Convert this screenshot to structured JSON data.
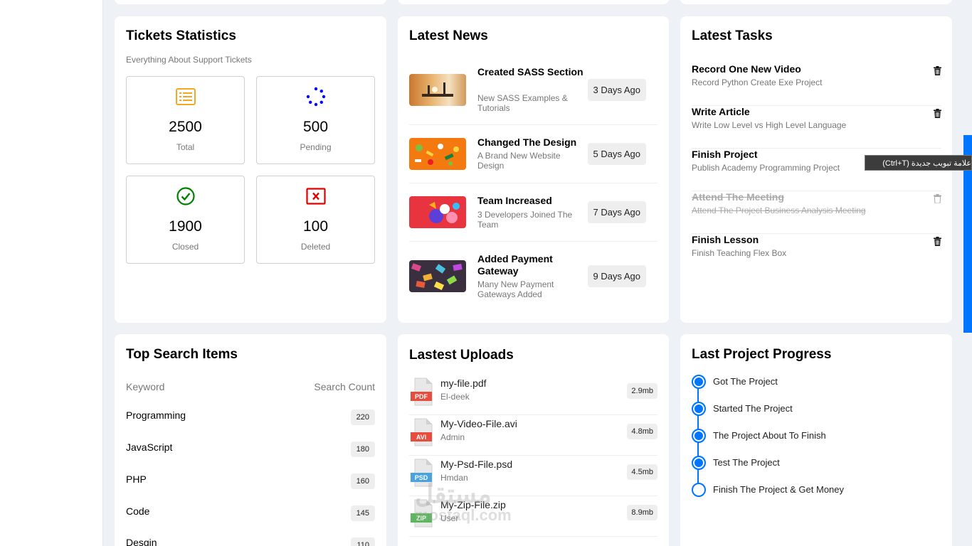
{
  "tickets": {
    "title": "Tickets Statistics",
    "subtitle": "Everything About Support Tickets",
    "items": [
      {
        "value": "2500",
        "label": "Total",
        "icon": "list-icon",
        "color": "#f5a623"
      },
      {
        "value": "500",
        "label": "Pending",
        "icon": "spinner-icon",
        "color": "#0000ff"
      },
      {
        "value": "1900",
        "label": "Closed",
        "icon": "check-circle-icon",
        "color": "#008000"
      },
      {
        "value": "100",
        "label": "Deleted",
        "icon": "x-square-icon",
        "color": "#e00000"
      }
    ]
  },
  "news": {
    "title": "Latest News",
    "items": [
      {
        "title": "Created SASS Section",
        "desc": "New SASS Examples & Tutorials",
        "date": "3 Days Ago"
      },
      {
        "title": "Changed The Design",
        "desc": "A Brand New Website Design",
        "date": "5 Days Ago"
      },
      {
        "title": "Team Increased",
        "desc": "3 Developers Joined The Team",
        "date": "7 Days Ago"
      },
      {
        "title": "Added Payment Gateway",
        "desc": "Many New Payment Gateways Added",
        "date": "9 Days Ago"
      }
    ]
  },
  "tasks": {
    "title": "Latest Tasks",
    "items": [
      {
        "title": "Record One New Video",
        "desc": "Record Python Create Exe Project",
        "done": false
      },
      {
        "title": "Write Article",
        "desc": "Write Low Level vs High Level Language",
        "done": false
      },
      {
        "title": "Finish Project",
        "desc": "Publish Academy Programming Project",
        "done": false
      },
      {
        "title": "Attend The Meeting",
        "desc": "Attend The Project Business Analysis Meeting",
        "done": true
      },
      {
        "title": "Finish Lesson",
        "desc": "Finish Teaching Flex Box",
        "done": false
      }
    ]
  },
  "tooltip": "علامة تبويب جديدة (Ctrl+T)",
  "search": {
    "title": "Top Search Items",
    "col_keyword": "Keyword",
    "col_count": "Search Count",
    "items": [
      {
        "keyword": "Programming",
        "count": "220"
      },
      {
        "keyword": "JavaScript",
        "count": "180"
      },
      {
        "keyword": "PHP",
        "count": "160"
      },
      {
        "keyword": "Code",
        "count": "145"
      },
      {
        "keyword": "Desgin",
        "count": "110"
      }
    ]
  },
  "uploads": {
    "title": "Lastest Uploads",
    "items": [
      {
        "name": "my-file.pdf",
        "user": "El-deek",
        "size": "2.9mb",
        "ext": "PDF",
        "color": "#e74c3c"
      },
      {
        "name": "My-Video-File.avi",
        "user": "Admin",
        "size": "4.8mb",
        "ext": "AVI",
        "color": "#e74c3c"
      },
      {
        "name": "My-Psd-File.psd",
        "user": "Hmdan",
        "size": "4.5mb",
        "ext": "PSD",
        "color": "#4aa3df"
      },
      {
        "name": "My-Zip-File.zip",
        "user": "User",
        "size": "8.9mb",
        "ext": "ZIP",
        "color": "#5cb85c"
      }
    ]
  },
  "progress": {
    "title": "Last Project Progress",
    "items": [
      {
        "label": "Got The Project",
        "done": true
      },
      {
        "label": "Started The Project",
        "done": true
      },
      {
        "label": "The Project About To Finish",
        "done": true
      },
      {
        "label": "Test The Project",
        "done": true
      },
      {
        "label": "Finish The Project & Get Money",
        "done": false
      }
    ]
  },
  "watermark": {
    "line1": "مستقل",
    "line2": "mostaql.com"
  }
}
